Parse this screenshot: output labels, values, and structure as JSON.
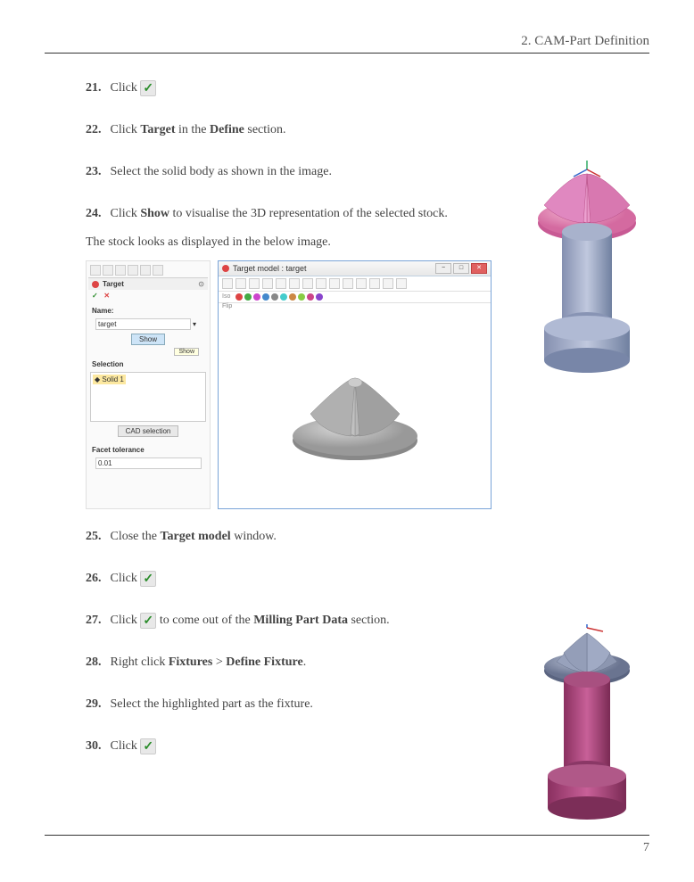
{
  "header": {
    "section": "2. CAM-Part Definition"
  },
  "steps": {
    "s21": {
      "num": "21.",
      "pre": "Click "
    },
    "s22": {
      "num": "22.",
      "pre": "Click ",
      "b1": "Target",
      "mid": " in the ",
      "b2": "Define",
      "post": " section."
    },
    "s23": {
      "num": "23.",
      "text": "Select the solid body as shown in the image."
    },
    "s24": {
      "num": "24.",
      "pre": "Click ",
      "b1": "Show",
      "post": " to visualise the 3D representation of the selected stock."
    },
    "sub24": "The stock looks as displayed in the below image.",
    "s25": {
      "num": "25.",
      "pre": "Close the ",
      "b1": "Target model",
      "post": " window."
    },
    "s26": {
      "num": "26.",
      "pre": "Click "
    },
    "s27": {
      "num": "27.",
      "pre": "Click ",
      "mid": " to come out of the ",
      "b1": "Milling Part Data",
      "post": " section."
    },
    "s28": {
      "num": "28.",
      "pre": "Right click ",
      "b1": "Fixtures",
      "mid": " > ",
      "b2": "Define Fixture",
      "post": "."
    },
    "s29": {
      "num": "29.",
      "text": "Select the highlighted part as the fixture."
    },
    "s30": {
      "num": "30.",
      "pre": "Click "
    }
  },
  "panel": {
    "title": "Target",
    "name_label": "Name:",
    "name_value": "target",
    "show_btn": "Show",
    "show_tip": "Show",
    "selection_label": "Selection",
    "solid_item": "Solid 1",
    "cad_btn": "CAD selection",
    "facet_label": "Facet tolerance",
    "facet_value": "0.01"
  },
  "viewer": {
    "title": "Target model : target",
    "iso_label": "Iso",
    "flip_label": "Flip"
  },
  "footer": {
    "page": "7"
  }
}
